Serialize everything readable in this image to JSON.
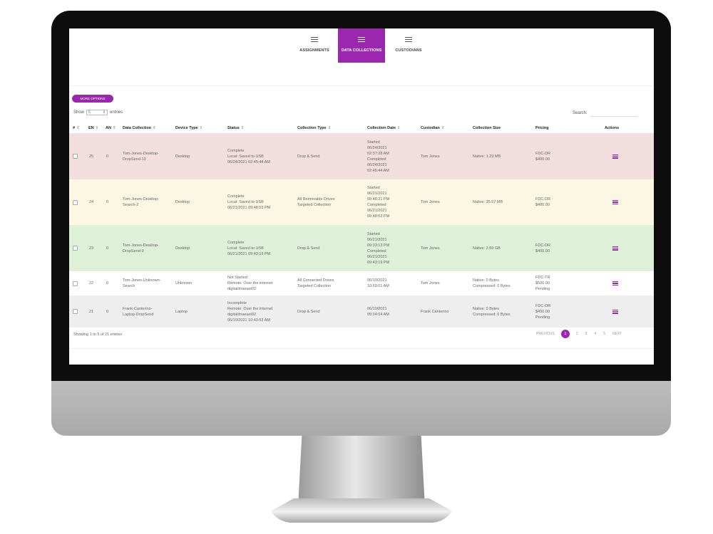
{
  "tabs": [
    {
      "label": "ASSIGNMENTS",
      "active": false
    },
    {
      "label": "DATA COLLECTIONS",
      "active": true
    },
    {
      "label": "CUSTODIANS",
      "active": false
    }
  ],
  "toolbar": {
    "more_options": "MORE OPTIONS"
  },
  "length": {
    "show": "Show",
    "value": "5",
    "entries": "entries"
  },
  "search": {
    "label": "Search:",
    "value": ""
  },
  "colors": {
    "accent": "#9b27af",
    "row_red": "#f3dede",
    "row_yellow": "#fcf7e2",
    "row_green": "#dff0d8",
    "row_gray": "#eeeeee"
  },
  "table": {
    "headers": {
      "num": "#",
      "en": "EN",
      "an": "AN",
      "collection": "Data Collection",
      "device": "Device Type",
      "status": "Status",
      "ctype": "Collection Type",
      "cdate": "Collection Date",
      "custodian": "Custodian",
      "size": "Collection Size",
      "pricing": "Pricing",
      "actions": "Actions"
    },
    "rows": [
      {
        "en": "25",
        "an": "0",
        "collection": "Tom-Jones-Desktop-\nDropSend-13",
        "device": "Desktop",
        "status": "Complete\nLocal: Saved to USB\n06/24/2021 02:45:44 AM",
        "ctype": "Drop & Send",
        "cdate": "Started\n06/24/2021\n02:37:28 AM\nCompleted\n06/24/2021\n02:45:44 AM",
        "custodian": "Tom Jones",
        "size": "Native: 1.29 MB",
        "pricing": "FDC-DR\n$400.00"
      },
      {
        "en": "24",
        "an": "0",
        "collection": "Tom-Jones-Desktop-\nSearch-2",
        "device": "Desktop",
        "status": "Complete\nLocal: Saved to USB\n06/21/2021 09:48:53 PM",
        "ctype": "All Removable Drives\nTargeted Collection",
        "cdate": "Started\n06/21/2021\n09:48:21 PM\nCompleted\n06/21/2021\n09:48:53 PM",
        "custodian": "Tom Jones",
        "size": "Native: 35.57 MB",
        "pricing": "FDC-DR\n$400.00"
      },
      {
        "en": "23",
        "an": "0",
        "collection": "Tom-Jones-Desktop-\nDropSend-9",
        "device": "Desktop",
        "status": "Complete\nLocal: Saved to USB\n06/21/2021 09:43:19 PM",
        "ctype": "Drop & Send",
        "cdate": "Started\n06/21/2021\n09:33:13 PM\nCompleted\n06/21/2021\n09:43:19 PM",
        "custodian": "Tom Jones",
        "size": "Native: 2.59 GB",
        "pricing": "FDC-DR\n$400.00"
      },
      {
        "en": "22",
        "an": "0",
        "collection": "Tom-Jones-Unknown-\nSearch",
        "device": "Unknown",
        "status": "Not Started\nRemote: Over the internet\ndigitaldnaeast02",
        "ctype": "All Connected Drives\nTargeted Collection",
        "cdate": "06/10/2021\n10:59:01 AM",
        "custodian": "Tom Jones",
        "size": "Native: 0 Bytes\nCompressed: 0 Bytes",
        "pricing": "FDC-TR\n$500.00\nPending"
      },
      {
        "en": "21",
        "an": "0",
        "collection": "Frank-Canterino-\nLaptop-DropSend",
        "device": "Laptop",
        "status": "Incomplete\nRemote: Over the internet\ndigitaldnaeast02\n06/10/2021 10:43:53 AM",
        "ctype": "Drop & Send",
        "cdate": "06/10/2021\n09:04:04 AM",
        "custodian": "Frank Canterino",
        "size": "Native: 0 Bytes\nCompressed: 0 Bytes",
        "pricing": "FDC-DR\n$400.00\nPending"
      }
    ]
  },
  "footer": {
    "info": "Showing 1 to 5 of 21 entries"
  },
  "pagination": {
    "previous": "PREVIOUS",
    "pages": [
      "1",
      "2",
      "3",
      "4",
      "5"
    ],
    "current": "1",
    "next": "NEXT"
  }
}
